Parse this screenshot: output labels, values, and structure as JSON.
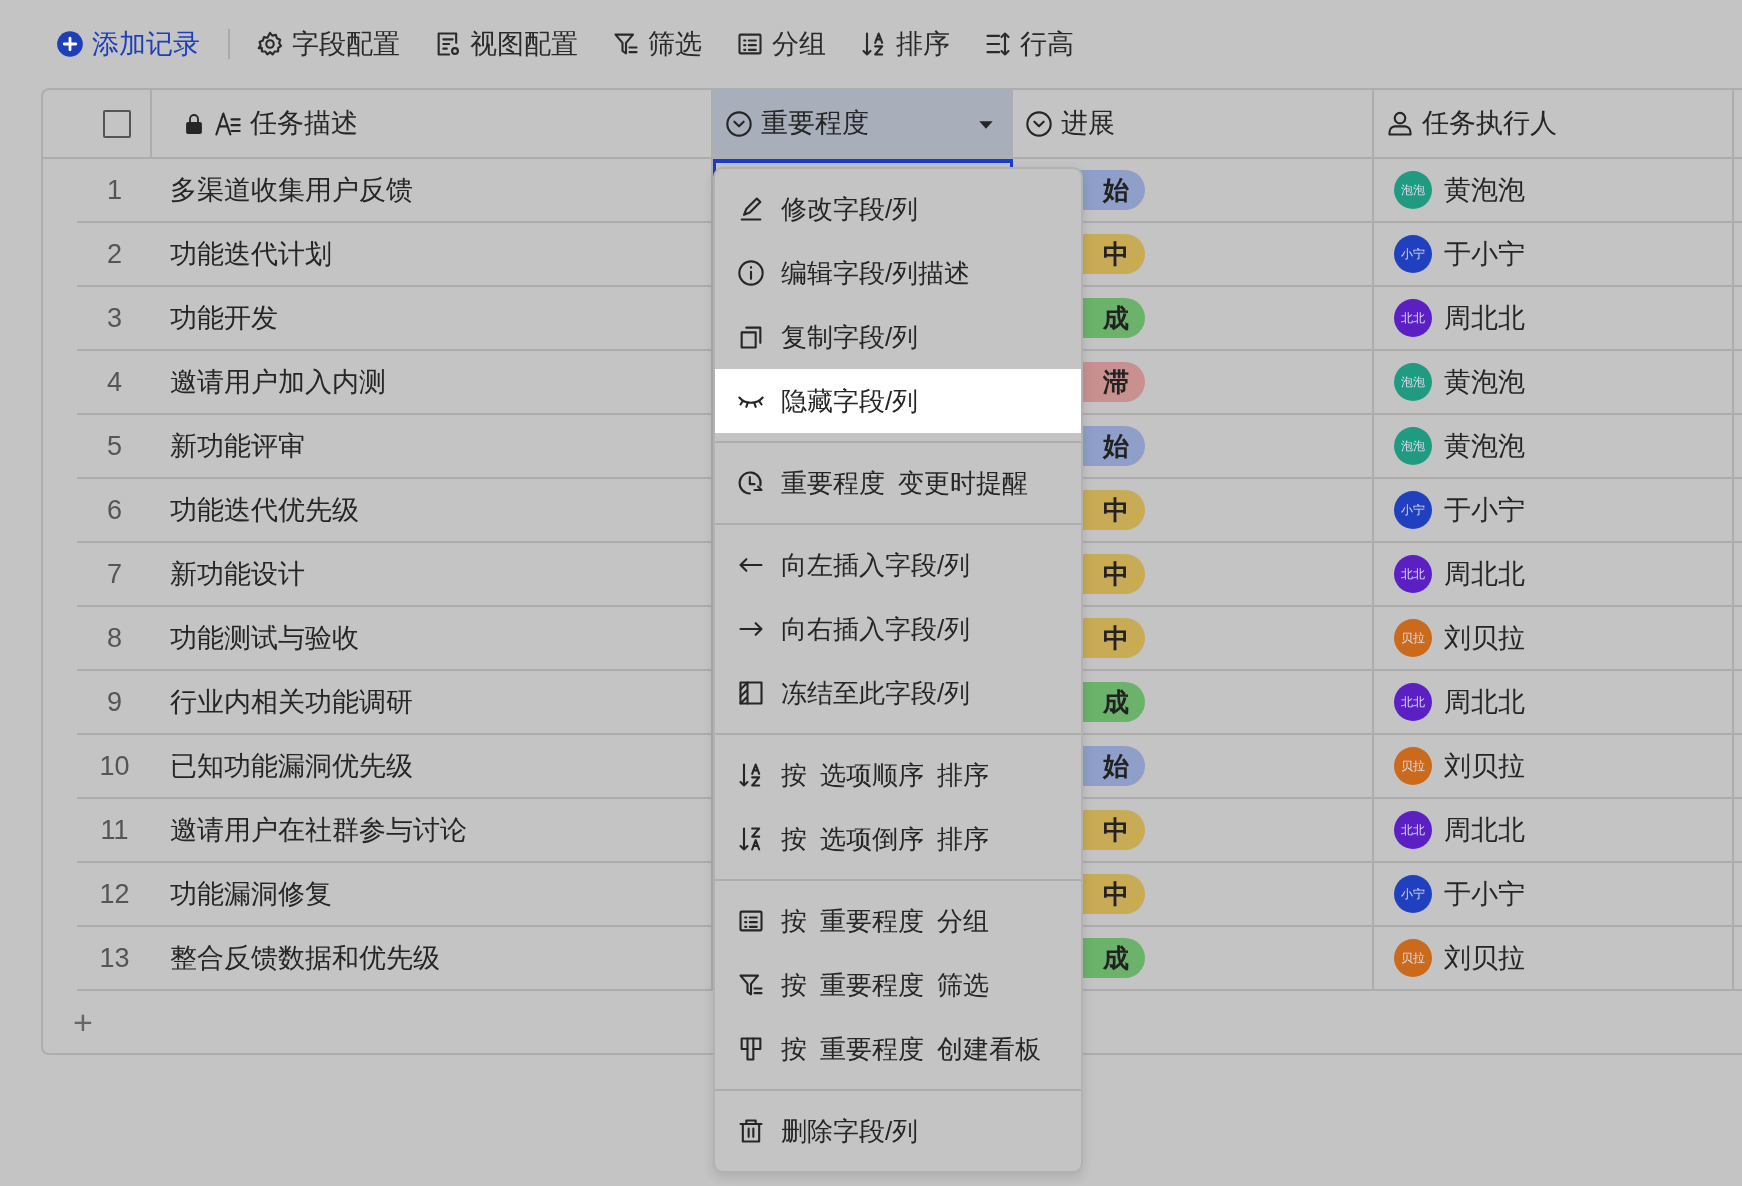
{
  "toolbar": [
    {
      "label": "添加记录",
      "kind": "primary"
    },
    {
      "label": "字段配置",
      "kind": "plain"
    },
    {
      "label": "视图配置",
      "kind": "plain"
    },
    {
      "label": "筛选",
      "kind": "plain"
    },
    {
      "label": "分组",
      "kind": "plain"
    },
    {
      "label": "排序",
      "kind": "plain"
    },
    {
      "label": "行高",
      "kind": "plain"
    }
  ],
  "select_all": {
    "checked": false
  },
  "columns": [
    {
      "label": "任务描述",
      "selected": false
    },
    {
      "label": "重要程度",
      "selected": true
    },
    {
      "label": "进展",
      "selected": false
    },
    {
      "label": "任务执行人",
      "selected": false
    }
  ],
  "rows": [
    {
      "number": "1",
      "task": "多渠道收集用户反馈",
      "progress": {
        "text": "始",
        "color": "#8f9fc9"
      },
      "assignee": {
        "avatar": "泡泡",
        "name": "黄泡泡",
        "color": "#1e9b80"
      }
    },
    {
      "number": "2",
      "task": "功能迭代计划",
      "progress": {
        "text": "中",
        "color": "#c9aa55"
      },
      "assignee": {
        "avatar": "小宁",
        "name": "于小宁",
        "color": "#2140c0"
      }
    },
    {
      "number": "3",
      "task": "功能开发",
      "progress": {
        "text": "成",
        "color": "#6bb26b"
      },
      "assignee": {
        "avatar": "北北",
        "name": "周北北",
        "color": "#5b1fc4"
      }
    },
    {
      "number": "4",
      "task": "邀请用户加入内测",
      "progress": {
        "text": "滞",
        "color": "#c99090"
      },
      "assignee": {
        "avatar": "泡泡",
        "name": "黄泡泡",
        "color": "#1e9b80"
      }
    },
    {
      "number": "5",
      "task": "新功能评审",
      "progress": {
        "text": "始",
        "color": "#8f9fc9"
      },
      "assignee": {
        "avatar": "泡泡",
        "name": "黄泡泡",
        "color": "#1e9b80"
      }
    },
    {
      "number": "6",
      "task": "功能迭代优先级",
      "progress": {
        "text": "中",
        "color": "#c9aa55"
      },
      "assignee": {
        "avatar": "小宁",
        "name": "于小宁",
        "color": "#2140c0"
      }
    },
    {
      "number": "7",
      "task": "新功能设计",
      "progress": {
        "text": "中",
        "color": "#c9aa55"
      },
      "assignee": {
        "avatar": "北北",
        "name": "周北北",
        "color": "#5b1fc4"
      }
    },
    {
      "number": "8",
      "task": "功能测试与验收",
      "progress": {
        "text": "中",
        "color": "#c9aa55"
      },
      "assignee": {
        "avatar": "贝拉",
        "name": "刘贝拉",
        "color": "#cc6a1c"
      }
    },
    {
      "number": "9",
      "task": "行业内相关功能调研",
      "progress": {
        "text": "成",
        "color": "#6bb26b"
      },
      "assignee": {
        "avatar": "北北",
        "name": "周北北",
        "color": "#5b1fc4"
      }
    },
    {
      "number": "10",
      "task": "已知功能漏洞优先级",
      "progress": {
        "text": "始",
        "color": "#8f9fc9"
      },
      "assignee": {
        "avatar": "贝拉",
        "name": "刘贝拉",
        "color": "#cc6a1c"
      }
    },
    {
      "number": "11",
      "task": "邀请用户在社群参与讨论",
      "progress": {
        "text": "中",
        "color": "#c9aa55"
      },
      "assignee": {
        "avatar": "北北",
        "name": "周北北",
        "color": "#5b1fc4"
      }
    },
    {
      "number": "12",
      "task": "功能漏洞修复",
      "progress": {
        "text": "中",
        "color": "#c9aa55"
      },
      "assignee": {
        "avatar": "小宁",
        "name": "于小宁",
        "color": "#2140c0"
      }
    },
    {
      "number": "13",
      "task": "整合反馈数据和优先级",
      "progress": {
        "text": "成",
        "color": "#6bb26b"
      },
      "assignee": {
        "avatar": "贝拉",
        "name": "刘贝拉",
        "color": "#cc6a1c"
      }
    }
  ],
  "add_row": "+",
  "menu": {
    "sections": [
      [
        {
          "label": "修改字段/列",
          "selected": false
        },
        {
          "label": "编辑字段/列描述",
          "selected": false
        },
        {
          "label": "复制字段/列",
          "selected": false
        },
        {
          "label": "隐藏字段/列",
          "selected": true
        }
      ],
      [
        {
          "label": "重要程度 变更时提醒",
          "selected": false
        }
      ],
      [
        {
          "label": "向左插入字段/列",
          "selected": false
        },
        {
          "label": "向右插入字段/列",
          "selected": false
        },
        {
          "label": "冻结至此字段/列",
          "selected": false
        }
      ],
      [
        {
          "label": "按 选项顺序 排序",
          "selected": false
        },
        {
          "label": "按 选项倒序 排序",
          "selected": false
        }
      ],
      [
        {
          "label": "按 重要程度 分组",
          "selected": false
        },
        {
          "label": "按 重要程度 筛选",
          "selected": false
        },
        {
          "label": "按 重要程度 创建看板",
          "selected": false
        }
      ],
      [
        {
          "label": "删除字段/列",
          "selected": false
        }
      ]
    ]
  }
}
